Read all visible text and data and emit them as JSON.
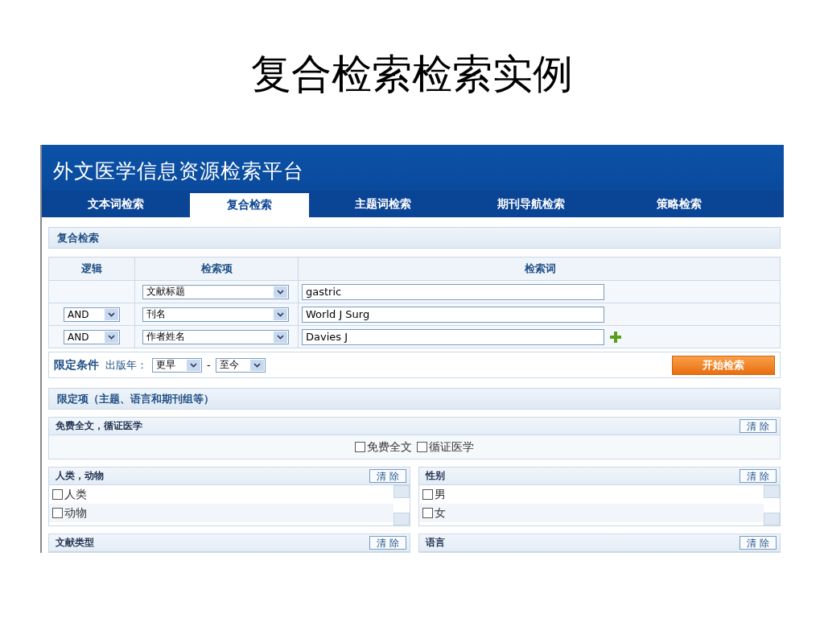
{
  "slide_title": "复合检索检索实例",
  "app": {
    "title": "外文医学信息资源检索平台",
    "tabs": [
      {
        "label": "文本词检索",
        "selected": false
      },
      {
        "label": "复合检索",
        "selected": true
      },
      {
        "label": "主题词检索",
        "selected": false
      },
      {
        "label": "期刊导航检索",
        "selected": false
      },
      {
        "label": "策略检索",
        "selected": false
      }
    ],
    "section_title": "复合检索",
    "query_table": {
      "columns": [
        "逻辑",
        "检索项",
        "检索词"
      ],
      "rows": [
        {
          "field": "文献标题",
          "term": "gastric",
          "add": false
        },
        {
          "logic": "AND",
          "field": "刊名",
          "term": "World J Surg",
          "add": false
        },
        {
          "logic": "AND",
          "field": "作者姓名",
          "term": "Davies J",
          "add": true
        }
      ]
    },
    "limits": {
      "label": "限定条件",
      "year_label": "出版年：",
      "from": "更早",
      "separator": "-",
      "to": "至今",
      "search_button": "开始检索"
    },
    "filters_title": "限定项（主题、语言和期刊组等）",
    "panels": [
      {
        "kind": "inline",
        "title": "免费全文，循证医学",
        "clear": "清 除",
        "options": [
          {
            "label": "免费全文",
            "checked": false
          },
          {
            "label": "循证医学",
            "checked": false
          }
        ]
      },
      {
        "kind": "list",
        "title": "人类，动物",
        "clear": "清 除",
        "options": [
          {
            "label": "人类",
            "checked": false
          },
          {
            "label": "动物",
            "checked": false
          }
        ]
      },
      {
        "kind": "list",
        "title": "性别",
        "clear": "清 除",
        "options": [
          {
            "label": "男",
            "checked": false
          },
          {
            "label": "女",
            "checked": false
          }
        ]
      },
      {
        "kind": "list",
        "title": "文献类型",
        "clear": "清 除"
      },
      {
        "kind": "list",
        "title": "语言",
        "clear": "清 除"
      }
    ]
  }
}
